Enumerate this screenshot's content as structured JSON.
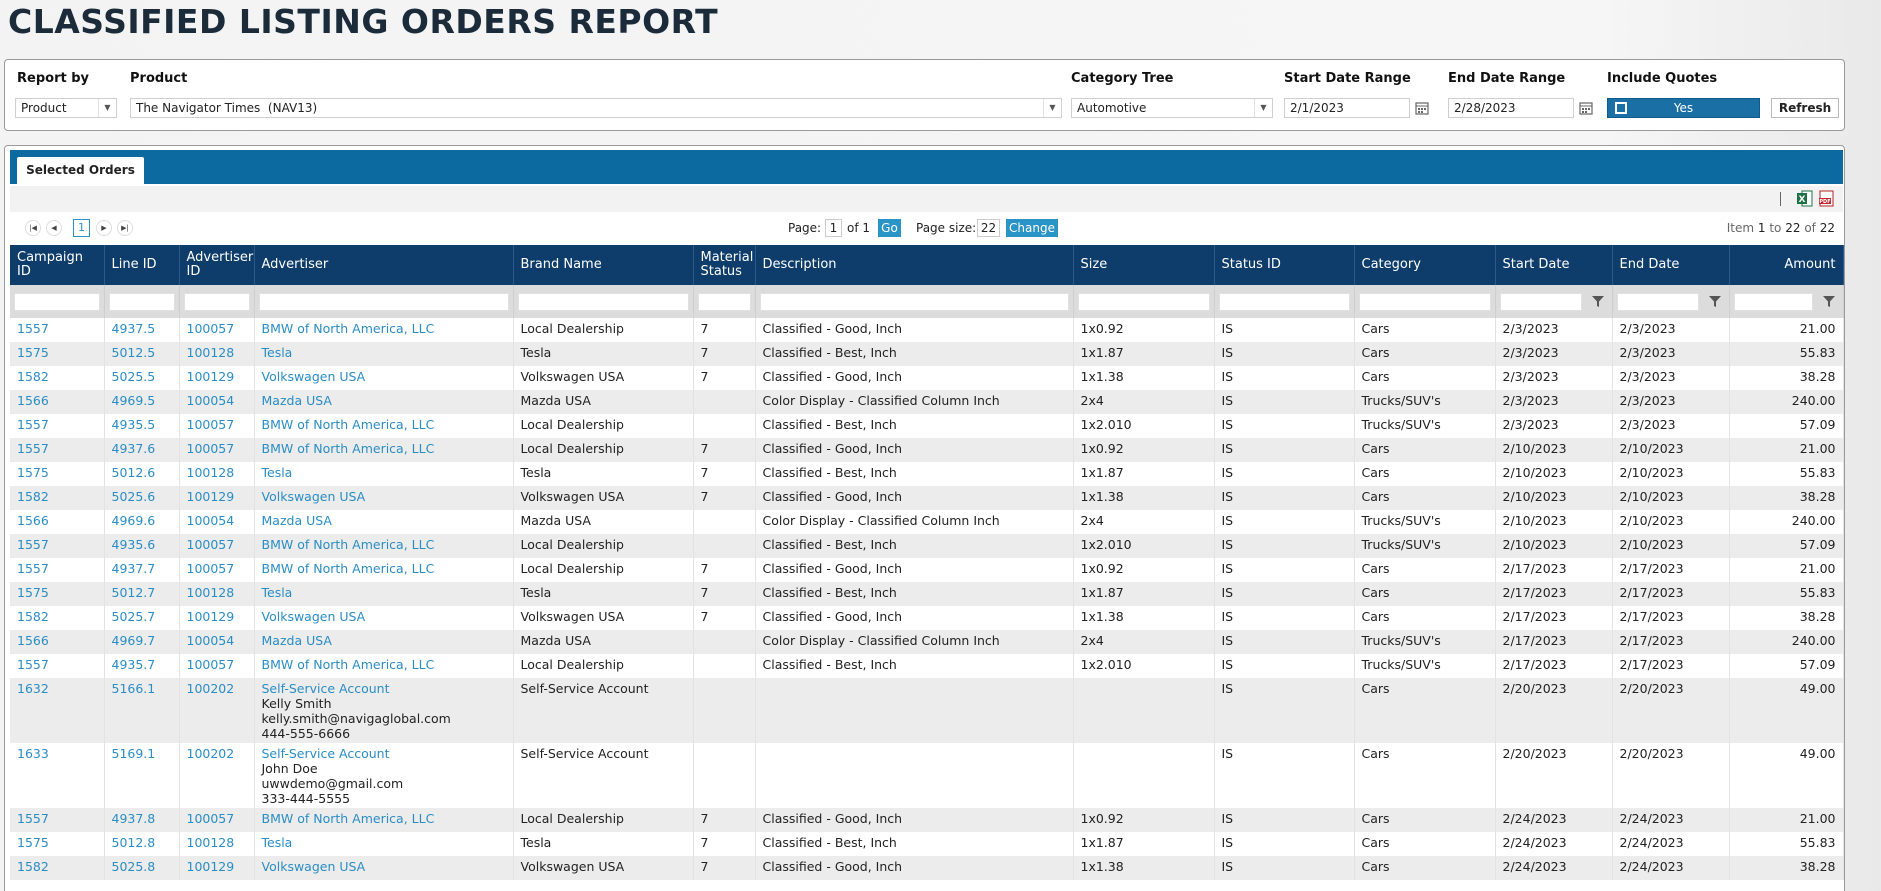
{
  "title": "CLASSIFIED LISTING ORDERS REPORT",
  "filters": {
    "report_by": {
      "label": "Report by",
      "value": "Product"
    },
    "product": {
      "label": "Product",
      "value": "The Navigator Times  (NAV13)"
    },
    "category_tree": {
      "label": "Category Tree",
      "value": "Automotive"
    },
    "start_date": {
      "label": "Start Date Range",
      "value": "2/1/2023"
    },
    "end_date": {
      "label": "End Date Range",
      "value": "2/28/2023"
    },
    "include_quotes": {
      "label": "Include Quotes",
      "value": "Yes"
    },
    "refresh_label": "Refresh"
  },
  "tabs": [
    {
      "label": "Selected Orders",
      "active": true
    }
  ],
  "toolbar": {
    "icons": [
      "excel-export-icon",
      "pdf-export-icon"
    ]
  },
  "pager": {
    "current_page": "1",
    "page_label": "Page:",
    "page_input": "1",
    "of_text": "of 1",
    "go_label": "Go",
    "page_size_label": "Page size:",
    "page_size": "22",
    "change_label": "Change",
    "item_prefix": "Item",
    "item_from": "1",
    "item_to_word": "to",
    "item_to": "22",
    "item_of_word": "of",
    "item_total": "22"
  },
  "columns": [
    "Campaign ID",
    "Line ID",
    "Advertiser ID",
    "Advertiser",
    "Brand Name",
    "Material Status",
    "Description",
    "Size",
    "Status ID",
    "Category",
    "Start Date",
    "End Date",
    "Amount"
  ],
  "rows": [
    {
      "campaign_id": "1557",
      "line_id": "4937.5",
      "advertiser_id": "100057",
      "advertiser": "BMW of North America, LLC",
      "brand": "Local Dealership",
      "material": "7",
      "description": "Classified - Good, Inch",
      "size": "1x0.92",
      "status": "IS",
      "category": "Cars",
      "start": "2/3/2023",
      "end": "2/3/2023",
      "amount": "21.00"
    },
    {
      "campaign_id": "1575",
      "line_id": "5012.5",
      "advertiser_id": "100128",
      "advertiser": "Tesla",
      "brand": "Tesla",
      "material": "7",
      "description": "Classified - Best, Inch",
      "size": "1x1.87",
      "status": "IS",
      "category": "Cars",
      "start": "2/3/2023",
      "end": "2/3/2023",
      "amount": "55.83"
    },
    {
      "campaign_id": "1582",
      "line_id": "5025.5",
      "advertiser_id": "100129",
      "advertiser": "Volkswagen USA",
      "brand": "Volkswagen USA",
      "material": "7",
      "description": "Classified - Good, Inch",
      "size": "1x1.38",
      "status": "IS",
      "category": "Cars",
      "start": "2/3/2023",
      "end": "2/3/2023",
      "amount": "38.28"
    },
    {
      "campaign_id": "1566",
      "line_id": "4969.5",
      "advertiser_id": "100054",
      "advertiser": "Mazda USA",
      "brand": "Mazda USA",
      "material": "",
      "description": "Color Display - Classified Column Inch",
      "size": "2x4",
      "status": "IS",
      "category": "Trucks/SUV's",
      "start": "2/3/2023",
      "end": "2/3/2023",
      "amount": "240.00"
    },
    {
      "campaign_id": "1557",
      "line_id": "4935.5",
      "advertiser_id": "100057",
      "advertiser": "BMW of North America, LLC",
      "brand": "Local Dealership",
      "material": "",
      "description": "Classified - Best, Inch",
      "size": "1x2.010",
      "status": "IS",
      "category": "Trucks/SUV's",
      "start": "2/3/2023",
      "end": "2/3/2023",
      "amount": "57.09"
    },
    {
      "campaign_id": "1557",
      "line_id": "4937.6",
      "advertiser_id": "100057",
      "advertiser": "BMW of North America, LLC",
      "brand": "Local Dealership",
      "material": "7",
      "description": "Classified - Good, Inch",
      "size": "1x0.92",
      "status": "IS",
      "category": "Cars",
      "start": "2/10/2023",
      "end": "2/10/2023",
      "amount": "21.00"
    },
    {
      "campaign_id": "1575",
      "line_id": "5012.6",
      "advertiser_id": "100128",
      "advertiser": "Tesla",
      "brand": "Tesla",
      "material": "7",
      "description": "Classified - Best, Inch",
      "size": "1x1.87",
      "status": "IS",
      "category": "Cars",
      "start": "2/10/2023",
      "end": "2/10/2023",
      "amount": "55.83"
    },
    {
      "campaign_id": "1582",
      "line_id": "5025.6",
      "advertiser_id": "100129",
      "advertiser": "Volkswagen USA",
      "brand": "Volkswagen USA",
      "material": "7",
      "description": "Classified - Good, Inch",
      "size": "1x1.38",
      "status": "IS",
      "category": "Cars",
      "start": "2/10/2023",
      "end": "2/10/2023",
      "amount": "38.28"
    },
    {
      "campaign_id": "1566",
      "line_id": "4969.6",
      "advertiser_id": "100054",
      "advertiser": "Mazda USA",
      "brand": "Mazda USA",
      "material": "",
      "description": "Color Display - Classified Column Inch",
      "size": "2x4",
      "status": "IS",
      "category": "Trucks/SUV's",
      "start": "2/10/2023",
      "end": "2/10/2023",
      "amount": "240.00"
    },
    {
      "campaign_id": "1557",
      "line_id": "4935.6",
      "advertiser_id": "100057",
      "advertiser": "BMW of North America, LLC",
      "brand": "Local Dealership",
      "material": "",
      "description": "Classified - Best, Inch",
      "size": "1x2.010",
      "status": "IS",
      "category": "Trucks/SUV's",
      "start": "2/10/2023",
      "end": "2/10/2023",
      "amount": "57.09"
    },
    {
      "campaign_id": "1557",
      "line_id": "4937.7",
      "advertiser_id": "100057",
      "advertiser": "BMW of North America, LLC",
      "brand": "Local Dealership",
      "material": "7",
      "description": "Classified - Good, Inch",
      "size": "1x0.92",
      "status": "IS",
      "category": "Cars",
      "start": "2/17/2023",
      "end": "2/17/2023",
      "amount": "21.00"
    },
    {
      "campaign_id": "1575",
      "line_id": "5012.7",
      "advertiser_id": "100128",
      "advertiser": "Tesla",
      "brand": "Tesla",
      "material": "7",
      "description": "Classified - Best, Inch",
      "size": "1x1.87",
      "status": "IS",
      "category": "Cars",
      "start": "2/17/2023",
      "end": "2/17/2023",
      "amount": "55.83"
    },
    {
      "campaign_id": "1582",
      "line_id": "5025.7",
      "advertiser_id": "100129",
      "advertiser": "Volkswagen USA",
      "brand": "Volkswagen USA",
      "material": "7",
      "description": "Classified - Good, Inch",
      "size": "1x1.38",
      "status": "IS",
      "category": "Cars",
      "start": "2/17/2023",
      "end": "2/17/2023",
      "amount": "38.28"
    },
    {
      "campaign_id": "1566",
      "line_id": "4969.7",
      "advertiser_id": "100054",
      "advertiser": "Mazda USA",
      "brand": "Mazda USA",
      "material": "",
      "description": "Color Display - Classified Column Inch",
      "size": "2x4",
      "status": "IS",
      "category": "Trucks/SUV's",
      "start": "2/17/2023",
      "end": "2/17/2023",
      "amount": "240.00"
    },
    {
      "campaign_id": "1557",
      "line_id": "4935.7",
      "advertiser_id": "100057",
      "advertiser": "BMW of North America, LLC",
      "brand": "Local Dealership",
      "material": "",
      "description": "Classified - Best, Inch",
      "size": "1x2.010",
      "status": "IS",
      "category": "Trucks/SUV's",
      "start": "2/17/2023",
      "end": "2/17/2023",
      "amount": "57.09"
    },
    {
      "campaign_id": "1632",
      "line_id": "5166.1",
      "advertiser_id": "100202",
      "advertiser": "Self-Service Account",
      "advertiser_extra": [
        "Kelly Smith",
        "kelly.smith@navigaglobal.com",
        "444-555-6666"
      ],
      "brand": "Self-Service Account",
      "material": "",
      "description": "",
      "size": "",
      "status": "IS",
      "category": "Cars",
      "start": "2/20/2023",
      "end": "2/20/2023",
      "amount": "49.00"
    },
    {
      "campaign_id": "1633",
      "line_id": "5169.1",
      "advertiser_id": "100202",
      "advertiser": "Self-Service Account",
      "advertiser_extra": [
        "John Doe",
        "uwwdemo@gmail.com",
        "333-444-5555"
      ],
      "brand": "Self-Service Account",
      "material": "",
      "description": "",
      "size": "",
      "status": "IS",
      "category": "Cars",
      "start": "2/20/2023",
      "end": "2/20/2023",
      "amount": "49.00"
    },
    {
      "campaign_id": "1557",
      "line_id": "4937.8",
      "advertiser_id": "100057",
      "advertiser": "BMW of North America, LLC",
      "brand": "Local Dealership",
      "material": "7",
      "description": "Classified - Good, Inch",
      "size": "1x0.92",
      "status": "IS",
      "category": "Cars",
      "start": "2/24/2023",
      "end": "2/24/2023",
      "amount": "21.00"
    },
    {
      "campaign_id": "1575",
      "line_id": "5012.8",
      "advertiser_id": "100128",
      "advertiser": "Tesla",
      "brand": "Tesla",
      "material": "7",
      "description": "Classified - Best, Inch",
      "size": "1x1.87",
      "status": "IS",
      "category": "Cars",
      "start": "2/24/2023",
      "end": "2/24/2023",
      "amount": "55.83"
    },
    {
      "campaign_id": "1582",
      "line_id": "5025.8",
      "advertiser_id": "100129",
      "advertiser": "Volkswagen USA",
      "brand": "Volkswagen USA",
      "material": "7",
      "description": "Classified - Good, Inch",
      "size": "1x1.38",
      "status": "IS",
      "category": "Cars",
      "start": "2/24/2023",
      "end": "2/24/2023",
      "amount": "38.28"
    }
  ],
  "colors": {
    "header": "#0e3d6c",
    "tabbar": "#0d6aa1",
    "link": "#2a8dc5",
    "toggle": "#1a6fa4",
    "row_alt": "#ececec"
  }
}
